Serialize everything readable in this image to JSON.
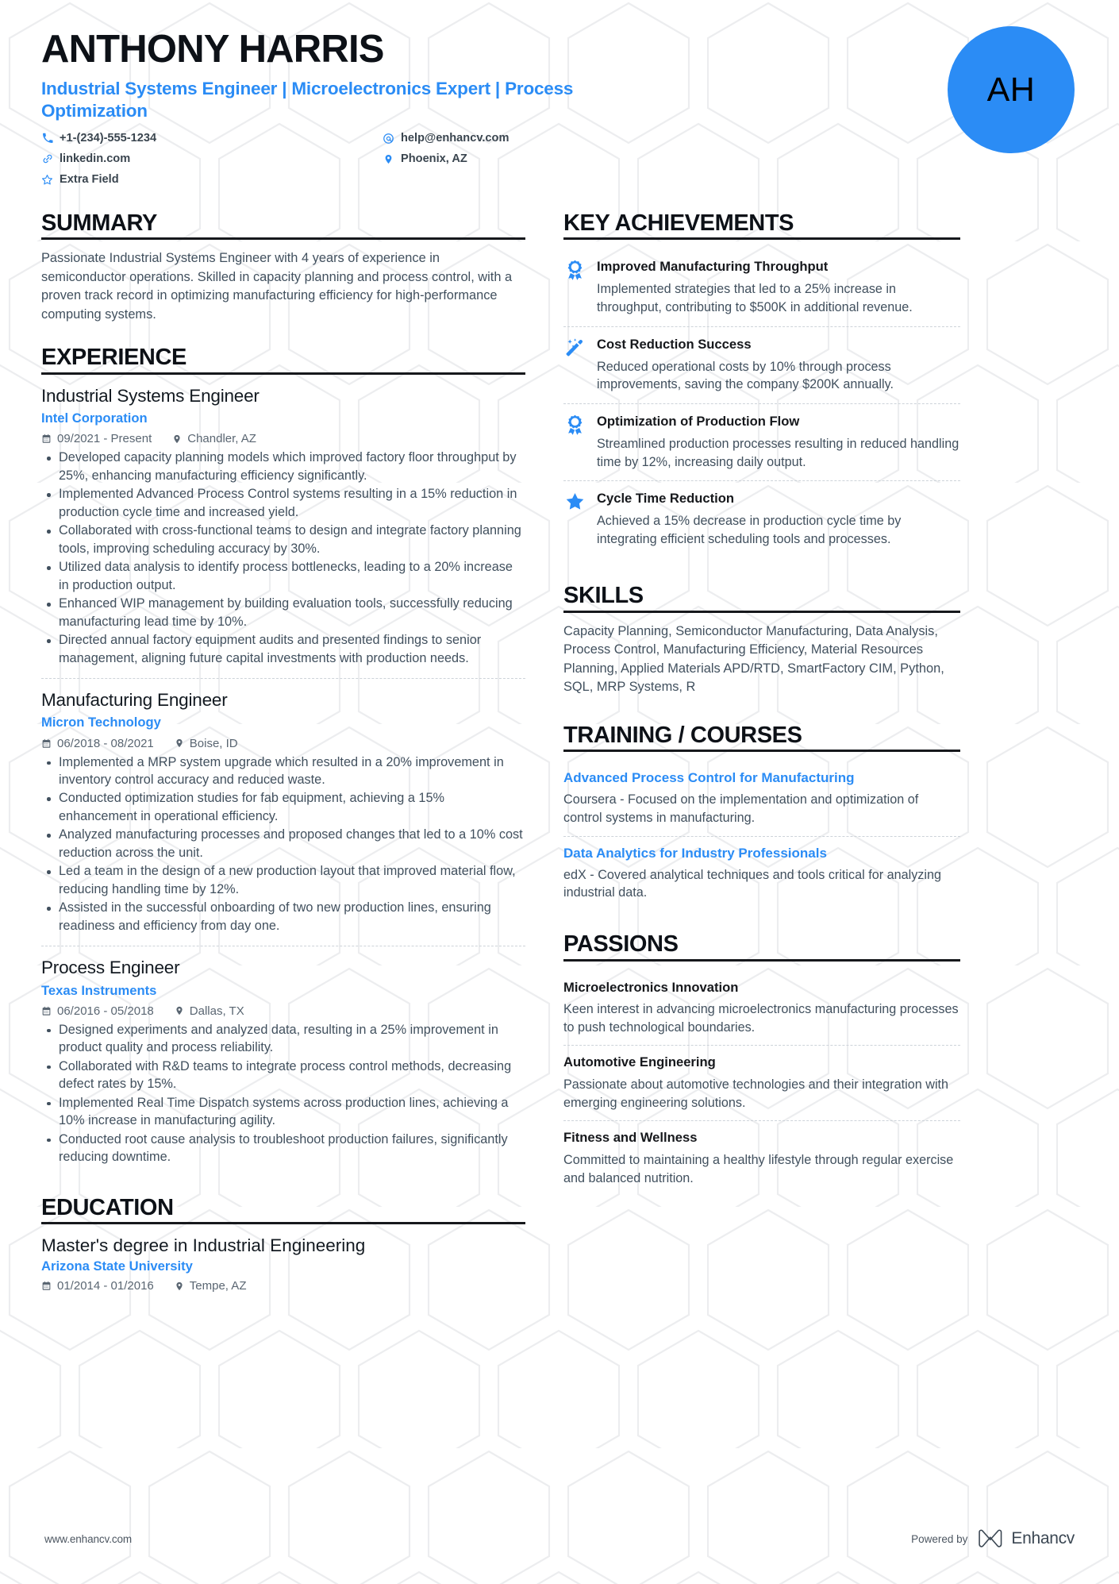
{
  "header": {
    "name": "ANTHONY HARRIS",
    "headline": "Industrial Systems Engineer | Microelectronics Expert | Process Optimization",
    "avatar_initials": "AH",
    "avatar_color": "#2B8CF5",
    "accent_color": "#2B8CF5",
    "contacts": [
      {
        "icon": "phone-icon",
        "value": "+1-(234)-555-1234"
      },
      {
        "icon": "email-icon",
        "value": "help@enhancv.com"
      },
      {
        "icon": "link-icon",
        "value": "linkedin.com"
      },
      {
        "icon": "location-icon",
        "value": "Phoenix, AZ"
      },
      {
        "icon": "star-outline-icon",
        "value": "Extra Field"
      }
    ]
  },
  "summary": {
    "heading": "SUMMARY",
    "text": "Passionate Industrial Systems Engineer with 4 years of experience in semiconductor operations. Skilled in capacity planning and process control, with a proven track record in optimizing manufacturing efficiency for high-performance computing systems."
  },
  "experience": {
    "heading": "EXPERIENCE",
    "jobs": [
      {
        "title": "Industrial Systems Engineer",
        "company": "Intel Corporation",
        "dates": "09/2021 - Present",
        "location": "Chandler, AZ",
        "bullets": [
          "Developed capacity planning models which improved factory floor throughput by 25%, enhancing manufacturing efficiency significantly.",
          "Implemented Advanced Process Control systems resulting in a 15% reduction in production cycle time and increased yield.",
          "Collaborated with cross-functional teams to design and integrate factory planning tools, improving scheduling accuracy by 30%.",
          "Utilized data analysis to identify process bottlenecks, leading to a 20% increase in production output.",
          "Enhanced WIP management by building evaluation tools, successfully reducing manufacturing lead time by 10%.",
          "Directed annual factory equipment audits and presented findings to senior management, aligning future capital investments with production needs."
        ]
      },
      {
        "title": "Manufacturing Engineer",
        "company": "Micron Technology",
        "dates": "06/2018 - 08/2021",
        "location": "Boise, ID",
        "bullets": [
          "Implemented a MRP system upgrade which resulted in a 20% improvement in inventory control accuracy and reduced waste.",
          "Conducted optimization studies for fab equipment, achieving a 15% enhancement in operational efficiency.",
          "Analyzed manufacturing processes and proposed changes that led to a 10% cost reduction across the unit.",
          "Led a team in the design of a new production layout that improved material flow, reducing handling time by 12%.",
          "Assisted in the successful onboarding of two new production lines, ensuring readiness and efficiency from day one."
        ]
      },
      {
        "title": "Process Engineer",
        "company": "Texas Instruments",
        "dates": "06/2016 - 05/2018",
        "location": "Dallas, TX",
        "bullets": [
          "Designed experiments and analyzed data, resulting in a 25% improvement in product quality and process reliability.",
          "Collaborated with R&D teams to integrate process control methods, decreasing defect rates by 15%.",
          "Implemented Real Time Dispatch systems across production lines, achieving a 10% increase in manufacturing agility.",
          "Conducted root cause analysis to troubleshoot production failures, significantly reducing downtime."
        ]
      }
    ]
  },
  "education": {
    "heading": "EDUCATION",
    "entries": [
      {
        "degree": "Master's degree in Industrial Engineering",
        "school": "Arizona State University",
        "dates": "01/2014 - 01/2016",
        "location": "Tempe, AZ"
      }
    ]
  },
  "achievements": {
    "heading": "KEY ACHIEVEMENTS",
    "items": [
      {
        "icon": "award-ribbon-icon",
        "title": "Improved Manufacturing Throughput",
        "text": "Implemented strategies that led to a 25% increase in throughput, contributing to $500K in additional revenue."
      },
      {
        "icon": "magic-wand-icon",
        "title": "Cost Reduction Success",
        "text": "Reduced operational costs by 10% through process improvements, saving the company $200K annually."
      },
      {
        "icon": "award-ribbon-icon",
        "title": "Optimization of Production Flow",
        "text": "Streamlined production processes resulting in reduced handling time by 12%, increasing daily output."
      },
      {
        "icon": "star-filled-icon",
        "title": "Cycle Time Reduction",
        "text": "Achieved a 15% decrease in production cycle time by integrating efficient scheduling tools and processes."
      }
    ]
  },
  "skills": {
    "heading": "SKILLS",
    "text": "Capacity Planning, Semiconductor Manufacturing, Data Analysis, Process Control, Manufacturing Efficiency, Material Resources Planning, Applied Materials APD/RTD, SmartFactory CIM, Python, SQL, MRP Systems, R"
  },
  "training": {
    "heading": "TRAINING / COURSES",
    "courses": [
      {
        "title": "Advanced Process Control for Manufacturing",
        "text": "Coursera - Focused on the implementation and optimization of control systems in manufacturing."
      },
      {
        "title": "Data Analytics for Industry Professionals",
        "text": "edX - Covered analytical techniques and tools critical for analyzing industrial data."
      }
    ]
  },
  "passions": {
    "heading": "PASSIONS",
    "items": [
      {
        "title": "Microelectronics Innovation",
        "text": "Keen interest in advancing microelectronics manufacturing processes to push technological boundaries."
      },
      {
        "title": "Automotive Engineering",
        "text": "Passionate about automotive technologies and their integration with emerging engineering solutions."
      },
      {
        "title": "Fitness and Wellness",
        "text": "Committed to maintaining a healthy lifestyle through regular exercise and balanced nutrition."
      }
    ]
  },
  "footer": {
    "website": "www.enhancv.com",
    "powered_by": "Powered by",
    "brand": "Enhancv"
  }
}
